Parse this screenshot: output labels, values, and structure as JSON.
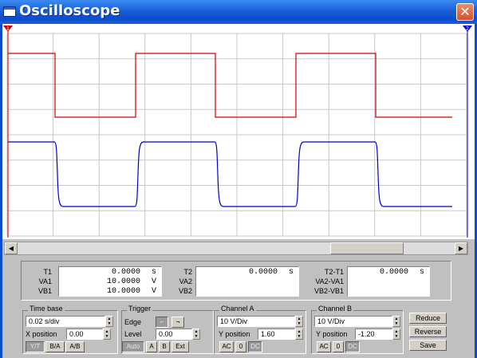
{
  "window": {
    "title": "Oscilloscope",
    "close_glyph": "✕"
  },
  "scope": {
    "background": "#ffffff",
    "grid_color": "#c8c8c8",
    "channel_a_color": "#d00000",
    "channel_b_color": "#0000cc",
    "cursor_1_label": "1",
    "cursor_2_label": "2",
    "cursor_1_color": "#d00000",
    "cursor_2_color": "#0000cc"
  },
  "scrollbar": {
    "left_arrow": "◀",
    "right_arrow": "▶"
  },
  "readout": {
    "t1_label": "T1",
    "t1_value": "0.0000",
    "t1_unit": "s",
    "va1_label": "VA1",
    "va1_value": "10.0000",
    "va1_unit": "V",
    "vb1_label": "VB1",
    "vb1_value": "10.0000",
    "vb1_unit": "V",
    "t2_label": "T2",
    "t2_value": "0.0000",
    "t2_unit": "s",
    "va2_label": "VA2",
    "vb2_label": "VB2",
    "t21_label": "T2-T1",
    "t21_value": "0.0000",
    "t21_unit": "s",
    "va21_label": "VA2-VA1",
    "vb21_label": "VB2-VB1"
  },
  "timebase": {
    "title": "Time base",
    "scale": "0.02 s/div",
    "xpos_label": "X position",
    "xpos_value": "0.00",
    "mode_yt": "Y/T",
    "mode_ba": "B/A",
    "mode_ab": "A/B"
  },
  "trigger": {
    "title": "Trigger",
    "edge_label": "Edge",
    "level_label": "Level",
    "level_value": "0.00",
    "auto_label": "Auto",
    "a_label": "A",
    "b_label": "B",
    "ext_label": "Ext"
  },
  "channel_a": {
    "title": "Channel A",
    "scale": "10 V/Div",
    "ypos_label": "Y position",
    "ypos_value": "1.60",
    "ac": "AC",
    "zero": "0",
    "dc": "DC"
  },
  "channel_b": {
    "title": "Channel B",
    "scale": "10 V/Div",
    "ypos_label": "Y position",
    "ypos_value": "-1.20",
    "ac": "AC",
    "zero": "0",
    "dc": "DC"
  },
  "actions": {
    "reduce": "Reduce",
    "reverse": "Reverse",
    "save": "Save"
  },
  "chart_data": {
    "type": "line",
    "x_divisions": 10,
    "y_divisions": 8,
    "series": [
      {
        "x": [
          0,
          0,
          1.5,
          1.5,
          4,
          4,
          6.5,
          6.5,
          9,
          9,
          11.4,
          11.4,
          14
        ],
        "y": [
          0,
          1,
          1,
          0,
          0,
          1,
          1,
          0,
          0,
          1,
          1,
          0,
          0
        ]
      },
      {
        "x": [
          0,
          0,
          1.5,
          1.5,
          4,
          4,
          6.5,
          6.5,
          9,
          9,
          11.4,
          11.4,
          14
        ],
        "y": [
          0,
          1,
          1,
          0,
          0,
          1,
          1,
          0,
          0,
          1,
          1,
          0,
          0
        ]
      }
    ]
  }
}
